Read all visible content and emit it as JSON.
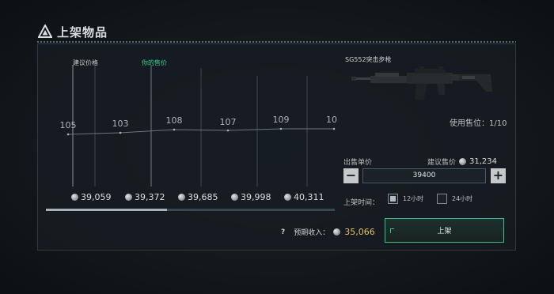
{
  "title": "上架物品",
  "chart": {
    "suggest_line_label": "建议价格",
    "my_price_line_label": "你的售价",
    "point_labels": [
      "105",
      "103",
      "108",
      "107",
      "109",
      "10"
    ],
    "price_ticks": [
      "39,059",
      "39,372",
      "39,685",
      "39,998",
      "40,311"
    ],
    "scroll_progress": 0.42
  },
  "item": {
    "name": "SG552突击步枪",
    "usage": "使用售位：1/10"
  },
  "price": {
    "single_label": "出售单价",
    "suggest_label": "建议售价",
    "suggest_value": "31,234",
    "value": "39400",
    "minus": "−",
    "plus": "+"
  },
  "duration": {
    "label": "上架时间：",
    "options": [
      {
        "label": "12小时",
        "selected": true
      },
      {
        "label": "24小时",
        "selected": false
      }
    ]
  },
  "income": {
    "help": "?",
    "label": "预期收入：",
    "value": "35,066"
  },
  "list_button": "上架",
  "colors": {
    "accent_green": "#2fc48b",
    "gold": "#e5c15f"
  }
}
